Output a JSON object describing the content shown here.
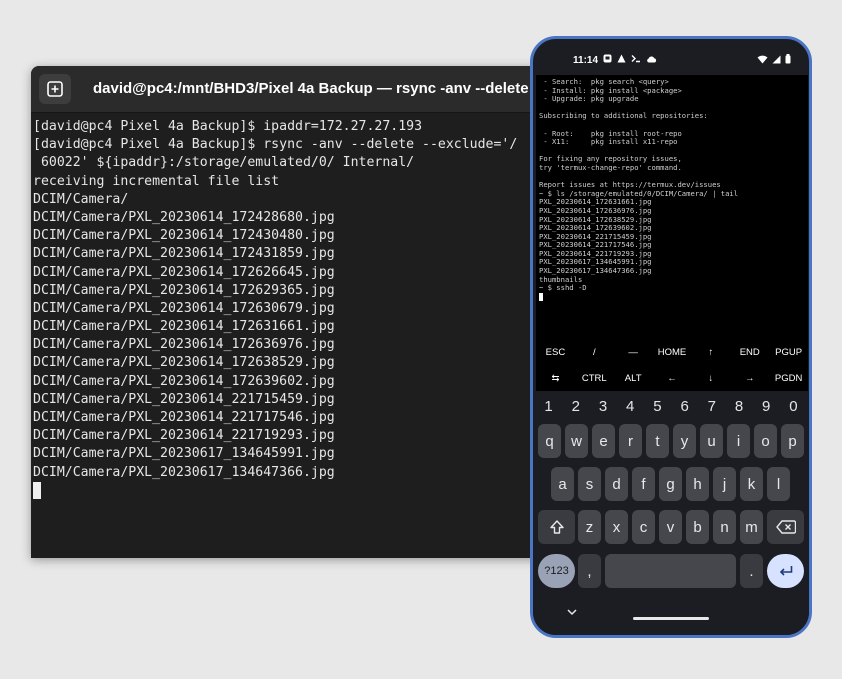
{
  "terminal": {
    "title": "david@pc4:/mnt/BHD3/Pixel 4a Backup — rsync -anv --delete --",
    "lines": [
      "[david@pc4 Pixel 4a Backup]$ ipaddr=172.27.27.193",
      "[david@pc4 Pixel 4a Backup]$ rsync -anv --delete --exclude='/",
      " 60022' ${ipaddr}:/storage/emulated/0/ Internal/",
      "receiving incremental file list",
      "DCIM/Camera/",
      "DCIM/Camera/PXL_20230614_172428680.jpg",
      "DCIM/Camera/PXL_20230614_172430480.jpg",
      "DCIM/Camera/PXL_20230614_172431859.jpg",
      "DCIM/Camera/PXL_20230614_172626645.jpg",
      "DCIM/Camera/PXL_20230614_172629365.jpg",
      "DCIM/Camera/PXL_20230614_172630679.jpg",
      "DCIM/Camera/PXL_20230614_172631661.jpg",
      "DCIM/Camera/PXL_20230614_172636976.jpg",
      "DCIM/Camera/PXL_20230614_172638529.jpg",
      "DCIM/Camera/PXL_20230614_172639602.jpg",
      "DCIM/Camera/PXL_20230614_221715459.jpg",
      "DCIM/Camera/PXL_20230614_221717546.jpg",
      "DCIM/Camera/PXL_20230614_221719293.jpg",
      "DCIM/Camera/PXL_20230617_134645991.jpg",
      "DCIM/Camera/PXL_20230617_134647366.jpg"
    ]
  },
  "phone": {
    "status": {
      "time": "11:14"
    },
    "termux_lines": [
      " - Search:  pkg search <query>",
      " - Install: pkg install <package>",
      " - Upgrade: pkg upgrade",
      "",
      "Subscribing to additional repositories:",
      "",
      " - Root:    pkg install root-repo",
      " - X11:     pkg install x11-repo",
      "",
      "For fixing any repository issues,",
      "try 'termux-change-repo' command.",
      "",
      "Report issues at https://termux.dev/issues",
      "~ $ ls /storage/emulated/0/DCIM/Camera/ | tail",
      "PXL_20230614_172631661.jpg",
      "PXL_20230614_172636976.jpg",
      "PXL_20230614_172638529.jpg",
      "PXL_20230614_172639602.jpg",
      "PXL_20230614_221715459.jpg",
      "PXL_20230614_221717546.jpg",
      "PXL_20230614_221719293.jpg",
      "PXL_20230617_134645991.jpg",
      "PXL_20230617_134647366.jpg",
      "thumbnails",
      "~ $ sshd -D"
    ],
    "extra_keys_row1": [
      "ESC",
      "/",
      "—",
      "HOME",
      "↑",
      "END",
      "PGUP"
    ],
    "extra_keys_row2": [
      "⇆",
      "CTRL",
      "ALT",
      "←",
      "↓",
      "→",
      "PGDN"
    ],
    "keyboard": {
      "numbers": [
        "1",
        "2",
        "3",
        "4",
        "5",
        "6",
        "7",
        "8",
        "9",
        "0"
      ],
      "row1": [
        "q",
        "w",
        "e",
        "r",
        "t",
        "y",
        "u",
        "i",
        "o",
        "p"
      ],
      "row2": [
        "a",
        "s",
        "d",
        "f",
        "g",
        "h",
        "j",
        "k",
        "l"
      ],
      "row3": [
        "z",
        "x",
        "c",
        "v",
        "b",
        "n",
        "m"
      ],
      "symbols_label": "?123",
      "comma": ",",
      "period": "."
    }
  },
  "colors": {
    "desktop_bg": "#e8e8e8",
    "terminal_bg": "#1e1e1e",
    "phone_frame": "#4a75c4",
    "enter_key": "#d6e2ff"
  }
}
